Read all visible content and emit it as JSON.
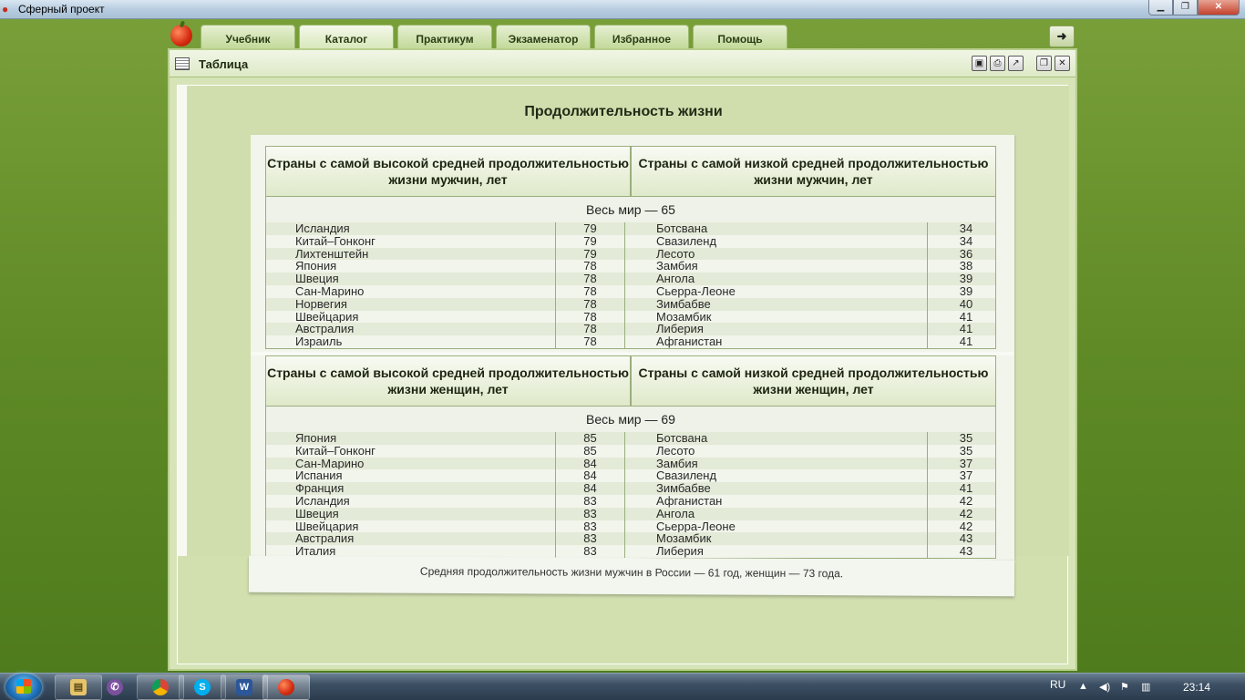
{
  "window": {
    "title": "Сферный проект"
  },
  "tabs": [
    {
      "label": "Учебник"
    },
    {
      "label": "Каталог"
    },
    {
      "label": "Практикум"
    },
    {
      "label": "Экзаменатор"
    },
    {
      "label": "Избранное"
    },
    {
      "label": "Помощь"
    }
  ],
  "panel": {
    "title": "Таблица"
  },
  "main_title": "Продолжительность жизни",
  "men": {
    "head_high": "Страны с самой высокой средней продолжительностью жизни мужчин, лет",
    "head_low": "Страны с самой низкой средней продолжительностью жизни мужчин, лет",
    "world": "Весь мир — 65",
    "rows": [
      {
        "c1": "Исландия",
        "v1": "79",
        "c2": "Ботсвана",
        "v2": "34"
      },
      {
        "c1": "Китай–Гонконг",
        "v1": "79",
        "c2": "Свазиленд",
        "v2": "34"
      },
      {
        "c1": "Лихтенштейн",
        "v1": "79",
        "c2": "Лесото",
        "v2": "36"
      },
      {
        "c1": "Япония",
        "v1": "78",
        "c2": "Замбия",
        "v2": "38"
      },
      {
        "c1": "Швеция",
        "v1": "78",
        "c2": "Ангола",
        "v2": "39"
      },
      {
        "c1": "Сан-Марино",
        "v1": "78",
        "c2": "Сьерра-Леоне",
        "v2": "39"
      },
      {
        "c1": "Норвегия",
        "v1": "78",
        "c2": "Зимбабве",
        "v2": "40"
      },
      {
        "c1": "Швейцария",
        "v1": "78",
        "c2": "Мозамбик",
        "v2": "41"
      },
      {
        "c1": "Австралия",
        "v1": "78",
        "c2": "Либерия",
        "v2": "41"
      },
      {
        "c1": "Израиль",
        "v1": "78",
        "c2": "Афганистан",
        "v2": "41"
      }
    ]
  },
  "women": {
    "head_high": "Страны с самой высокой средней продолжительностью жизни женщин, лет",
    "head_low": "Страны с самой низкой средней продолжительностью жизни женщин, лет",
    "world": "Весь мир — 69",
    "rows": [
      {
        "c1": "Япония",
        "v1": "85",
        "c2": "Ботсвана",
        "v2": "35"
      },
      {
        "c1": "Китай–Гонконг",
        "v1": "85",
        "c2": "Лесото",
        "v2": "35"
      },
      {
        "c1": "Сан-Марино",
        "v1": "84",
        "c2": "Замбия",
        "v2": "37"
      },
      {
        "c1": "Испания",
        "v1": "84",
        "c2": "Свазиленд",
        "v2": "37"
      },
      {
        "c1": "Франция",
        "v1": "84",
        "c2": "Зимбабве",
        "v2": "41"
      },
      {
        "c1": "Исландия",
        "v1": "83",
        "c2": "Афганистан",
        "v2": "42"
      },
      {
        "c1": "Швеция",
        "v1": "83",
        "c2": "Ангола",
        "v2": "42"
      },
      {
        "c1": "Швейцария",
        "v1": "83",
        "c2": "Сьерра-Леоне",
        "v2": "42"
      },
      {
        "c1": "Австралия",
        "v1": "83",
        "c2": "Мозамбик",
        "v2": "43"
      },
      {
        "c1": "Италия",
        "v1": "83",
        "c2": "Либерия",
        "v2": "43"
      }
    ]
  },
  "footnote": "Средняя продолжительность жизни мужчин в России — 61 год, женщин — 73 года.",
  "taskbar": {
    "lang": "RU",
    "clock": "23:14"
  }
}
